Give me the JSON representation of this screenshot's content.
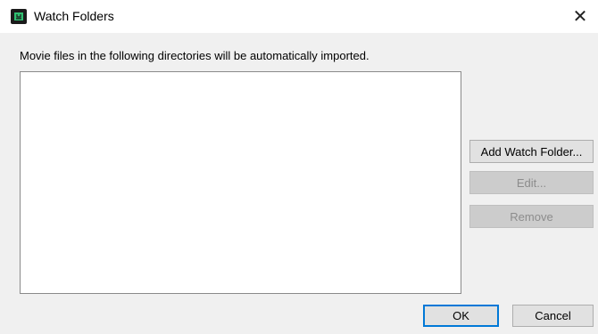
{
  "window": {
    "title": "Watch Folders",
    "close_glyph": "✕",
    "app_icon": "app-logo-icon"
  },
  "main": {
    "description": "Movie files in the following directories will be automatically imported.",
    "folders": []
  },
  "buttons": {
    "add": "Add Watch Folder...",
    "edit": "Edit...",
    "remove": "Remove",
    "ok": "OK",
    "cancel": "Cancel"
  },
  "colors": {
    "accent": "#0078d7",
    "icon_green": "#2fbf71"
  }
}
